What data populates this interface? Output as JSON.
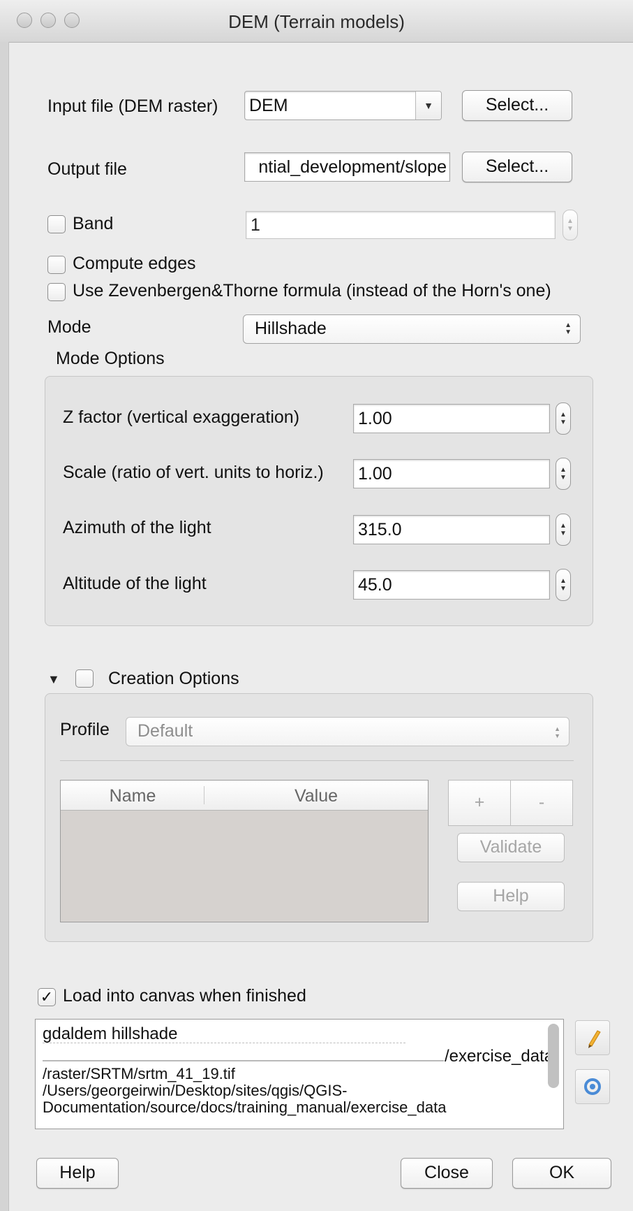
{
  "window": {
    "title": "DEM (Terrain models)"
  },
  "input_file": {
    "label": "Input file (DEM raster)",
    "value": "DEM",
    "select_label": "Select..."
  },
  "output_file": {
    "label": "Output file",
    "value": "ntial_development/slope",
    "select_label": "Select..."
  },
  "band": {
    "label": "Band",
    "checked": false,
    "value": "1"
  },
  "compute_edges": {
    "label": "Compute edges",
    "checked": false
  },
  "zevenbergen": {
    "label": "Use Zevenbergen&Thorne formula (instead of the Horn's one)",
    "checked": false
  },
  "mode": {
    "label": "Mode",
    "value": "Hillshade"
  },
  "mode_options": {
    "title": "Mode Options",
    "z_factor": {
      "label": "Z factor (vertical exaggeration)",
      "value": "1.00"
    },
    "scale": {
      "label": "Scale (ratio of vert. units to horiz.)",
      "value": "1.00"
    },
    "azimuth": {
      "label": "Azimuth of the light",
      "value": "315.0"
    },
    "altitude": {
      "label": "Altitude of the light",
      "value": "45.0"
    }
  },
  "creation_options": {
    "title": "Creation Options",
    "checked": false,
    "profile_label": "Profile",
    "profile_value": "Default",
    "columns": [
      "Name",
      "Value"
    ],
    "add_label": "+",
    "remove_label": "-",
    "validate_label": "Validate",
    "help_label": "Help"
  },
  "load_canvas": {
    "label": "Load into canvas when finished",
    "checked": true
  },
  "command": {
    "lines": [
      "gdaldem hillshade",
      "/exercise_data",
      "/raster/SRTM/srtm_41_19.tif",
      "/Users/georgeirwin/Desktop/sites/qgis/QGIS-",
      "Documentation/source/docs/training_manual/exercise_data"
    ]
  },
  "footer": {
    "help_label": "Help",
    "close_label": "Close",
    "ok_label": "OK"
  },
  "icons": {
    "edit": "pencil-icon",
    "reset": "refresh-icon",
    "collapse": "triangle-down-icon"
  },
  "colors": {
    "window_bg": "#ececec",
    "group_bg": "#e4e4e4",
    "table_body": "#d6d2cf"
  }
}
